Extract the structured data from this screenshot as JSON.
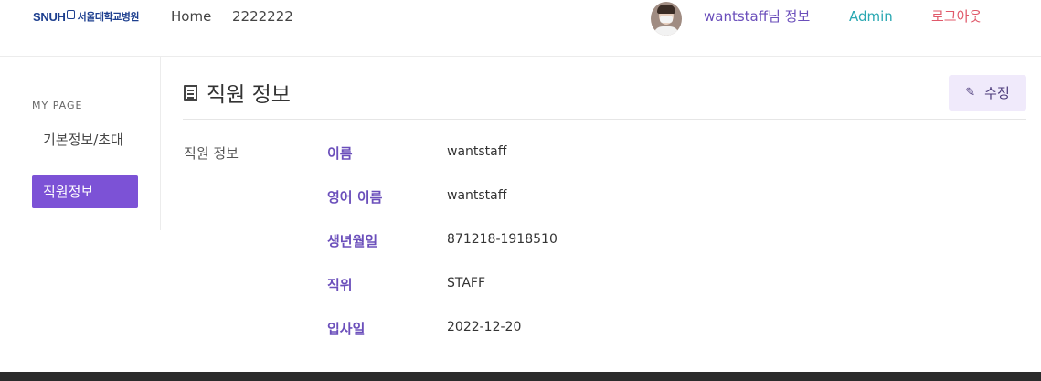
{
  "navbar": {
    "logo_en": "SNUH",
    "logo_ko": "서울대학교병원",
    "home": "Home",
    "link2": "2222222",
    "user": "wantstaff님 정보",
    "admin": "Admin",
    "logout": "로그아웃"
  },
  "sidebar": {
    "heading": "MY PAGE",
    "items": [
      {
        "label": "기본정보/초대"
      },
      {
        "label": "직원정보"
      }
    ]
  },
  "main": {
    "title": "직원 정보",
    "edit_label": "수정",
    "section_label": "직원 정보",
    "fields": [
      {
        "label": "이름",
        "value": "wantstaff"
      },
      {
        "label": "영어 이름",
        "value": "wantstaff"
      },
      {
        "label": "생년월일",
        "value": "871218-1918510"
      },
      {
        "label": "직위",
        "value": "STAFF"
      },
      {
        "label": "입사일",
        "value": "2022-12-20"
      }
    ]
  },
  "colors": {
    "accent": "#7c52d6",
    "label": "#6b4fbb",
    "admin": "#2aa8b2",
    "logout": "#e0596a",
    "brand": "#1d3f8f"
  },
  "icons": {
    "title": "document-list-icon",
    "edit": "edit-pen-icon"
  }
}
